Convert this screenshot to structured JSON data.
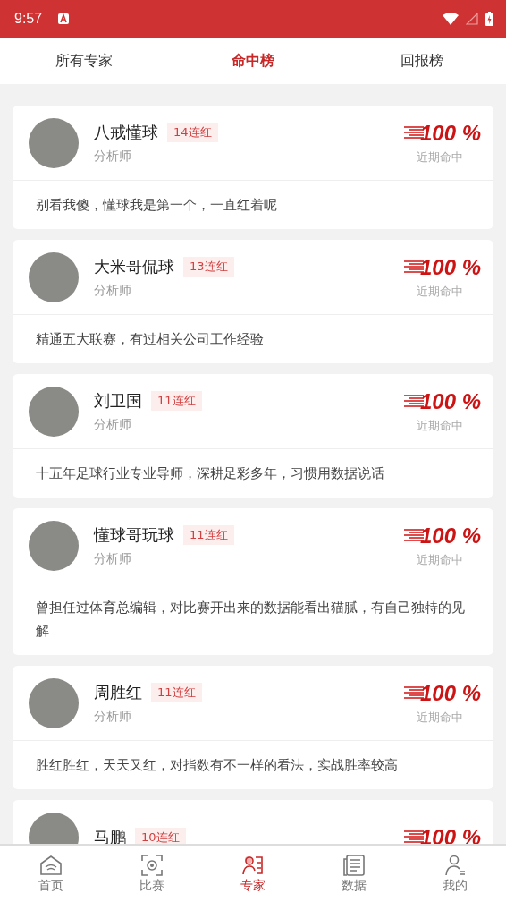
{
  "status_bar": {
    "time": "9:57"
  },
  "tabs": [
    {
      "label": "所有专家",
      "selected": false
    },
    {
      "label": "命中榜",
      "selected": true
    },
    {
      "label": "回报榜",
      "selected": false
    }
  ],
  "experts": [
    {
      "name": "八戒懂球",
      "streak": "14连红",
      "role": "分析师",
      "rate": "100 %",
      "rate_label": "近期命中",
      "bio": "别看我傻，懂球我是第一个，一直红着呢"
    },
    {
      "name": "大米哥侃球",
      "streak": "13连红",
      "role": "分析师",
      "rate": "100 %",
      "rate_label": "近期命中",
      "bio": "精通五大联赛，有过相关公司工作经验"
    },
    {
      "name": "刘卫国",
      "streak": "11连红",
      "role": "分析师",
      "rate": "100 %",
      "rate_label": "近期命中",
      "bio": "十五年足球行业专业导师，深耕足彩多年，习惯用数据说话"
    },
    {
      "name": "懂球哥玩球",
      "streak": "11连红",
      "role": "分析师",
      "rate": "100 %",
      "rate_label": "近期命中",
      "bio": "曾担任过体育总编辑，对比赛开出来的数据能看出猫腻，有自己独特的见解"
    },
    {
      "name": "周胜红",
      "streak": "11连红",
      "role": "分析师",
      "rate": "100 %",
      "rate_label": "近期命中",
      "bio": "胜红胜红，天天又红，对指数有不一样的看法，实战胜率较高"
    },
    {
      "name": "马鹏",
      "streak": "10连红",
      "rate": "100 %"
    }
  ],
  "bottom_nav": [
    {
      "label": "首页",
      "kind": "home",
      "selected": false
    },
    {
      "label": "比赛",
      "kind": "match",
      "selected": false
    },
    {
      "label": "专家",
      "kind": "expert",
      "selected": true
    },
    {
      "label": "数据",
      "kind": "data",
      "selected": false
    },
    {
      "label": "我的",
      "kind": "me",
      "selected": false
    }
  ]
}
